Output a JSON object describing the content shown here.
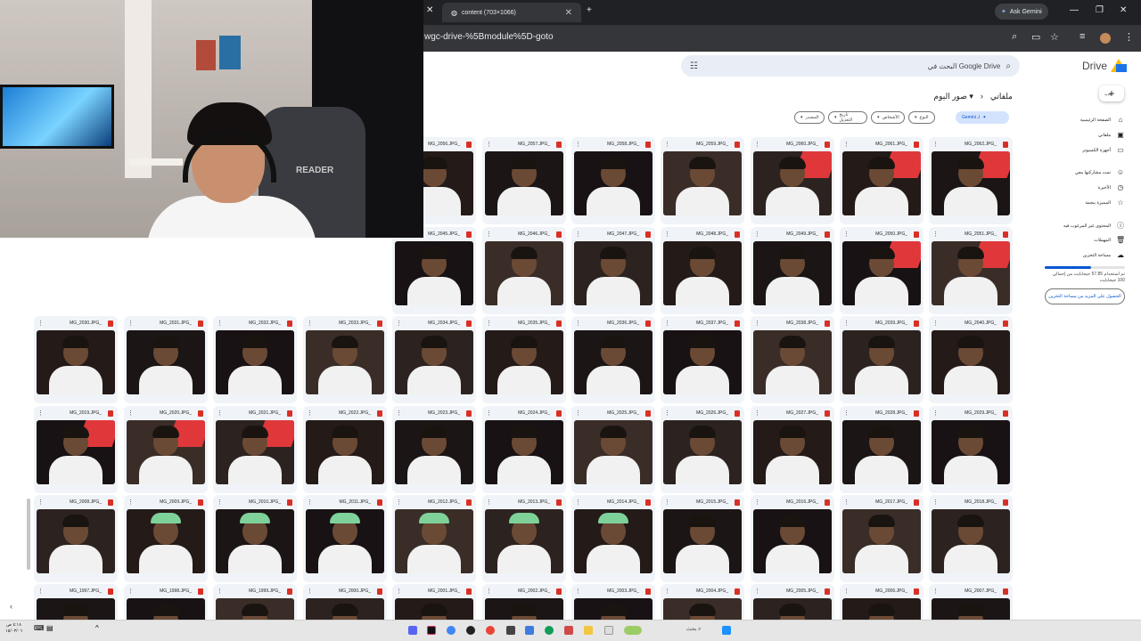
{
  "browser": {
    "tabs": [
      {
        "title": "content (703×1066)"
      }
    ],
    "ask_gemini": "Ask Gemini",
    "url": "wgc-drive-%5Bmodule%5D-goto"
  },
  "drive": {
    "logo": "Drive",
    "search_placeholder": "البحث في Google Drive",
    "breadcrumb_root": "ملفاتي",
    "breadcrumb_sep": "›",
    "breadcrumb_current": "صور اليوم",
    "chips": {
      "gemini": "Gemini لـ",
      "type": "النوع",
      "people": "الأشخاص",
      "modified": "تاريخ التعديل",
      "source": "المصدر"
    },
    "new_label": "جديد",
    "sidebar": [
      {
        "label": "الصفحة الرئيسية",
        "icon": "home-icon",
        "glyph": "⌂"
      },
      {
        "label": "ملفاتي",
        "icon": "drive-icon",
        "glyph": "▣"
      },
      {
        "label": "أجهزة الكمبيوتر",
        "icon": "computer-icon",
        "glyph": "▭"
      },
      {
        "label": "تمت مشاركتها معي",
        "icon": "people-icon",
        "glyph": "☺"
      },
      {
        "label": "الأخيرة",
        "icon": "clock-icon",
        "glyph": "◷"
      },
      {
        "label": "المميزة بنجمة",
        "icon": "star-icon",
        "glyph": "☆"
      },
      {
        "label": "المحتوى غير المرغوب فيه",
        "icon": "spam-icon",
        "glyph": "ⓘ"
      },
      {
        "label": "المهملات",
        "icon": "trash-icon",
        "glyph": "🗑"
      },
      {
        "label": "مساحة التخزين",
        "icon": "cloud-icon",
        "glyph": "☁"
      }
    ],
    "storage_text": "تم استخدام 57.85 جيجابايت من إجمالي 100 جيجابايت",
    "storage_used_fraction": 0.5785,
    "storage_button": "الحصول على المزيد من مساحة التخزين",
    "rows": [
      {
        "files": [
          "MG_2062.JPG_",
          "MG_2061.JPG_",
          "MG_2060.JPG_",
          "MG_2059.JPG_",
          "MG_2058.JPG_",
          "MG_2057.JPG_",
          "MG_2056.JPG_"
        ]
      },
      {
        "files": [
          "MG_2051.JPG_",
          "MG_2050.JPG_",
          "MG_2049.JPG_",
          "MG_2048.JPG_",
          "MG_2047.JPG_",
          "MG_2046.JPG_",
          "MG_2045.JPG_",
          "",
          "",
          "",
          ""
        ]
      },
      {
        "files": [
          "MG_2040.JPG_",
          "MG_2039.JPG_",
          "MG_2038.JPG_",
          "MG_2037.JPG_",
          "MG_2036.JPG_",
          "MG_2035.JPG_",
          "MG_2034.JPG_",
          "MG_2033.JPG_",
          "MG_2032.JPG_",
          "MG_2031.JPG_",
          "MG_2030.JPG_"
        ]
      },
      {
        "files": [
          "MG_2029.JPG_",
          "MG_2028.JPG_",
          "MG_2027.JPG_",
          "MG_2026.JPG_",
          "MG_2025.JPG_",
          "MG_2024.JPG_",
          "MG_2023.JPG_",
          "MG_2022.JPG_",
          "MG_2021.JPG_",
          "MG_2020.JPG_",
          "MG_2019.JPG_"
        ]
      },
      {
        "files": [
          "MG_2018.JPG_",
          "MG_2017.JPG_",
          "MG_2016.JPG_",
          "MG_2015.JPG_",
          "MG_2014.JPG_",
          "MG_2013.JPG_",
          "MG_2012.JPG_",
          "MG_2011.JPG_",
          "MG_2010.JPG_",
          "MG_2009.JPG_",
          "MG_2008.JPG_"
        ]
      },
      {
        "files": [
          "MG_2007.JPG_",
          "MG_2006.JPG_",
          "MG_2005.JPG_",
          "MG_2004.JPG_",
          "MG_2003.JPG_",
          "MG_2002.JPG_",
          "MG_2001.JPG_",
          "MG_2000.JPG_",
          "MG_1999.JPG_",
          "MG_1998.JPG_",
          "MG_1997.JPG_"
        ]
      }
    ]
  },
  "webcam": {
    "chair_text": "READER"
  },
  "taskbar": {
    "time": "٤:١٨ ص",
    "date": "١٥/٠٣/٠٦",
    "search_label": "بحث"
  },
  "colors": {
    "chrome_dark": "#202124",
    "drive_blue": "#0b57d0",
    "file_red": "#d93025"
  }
}
